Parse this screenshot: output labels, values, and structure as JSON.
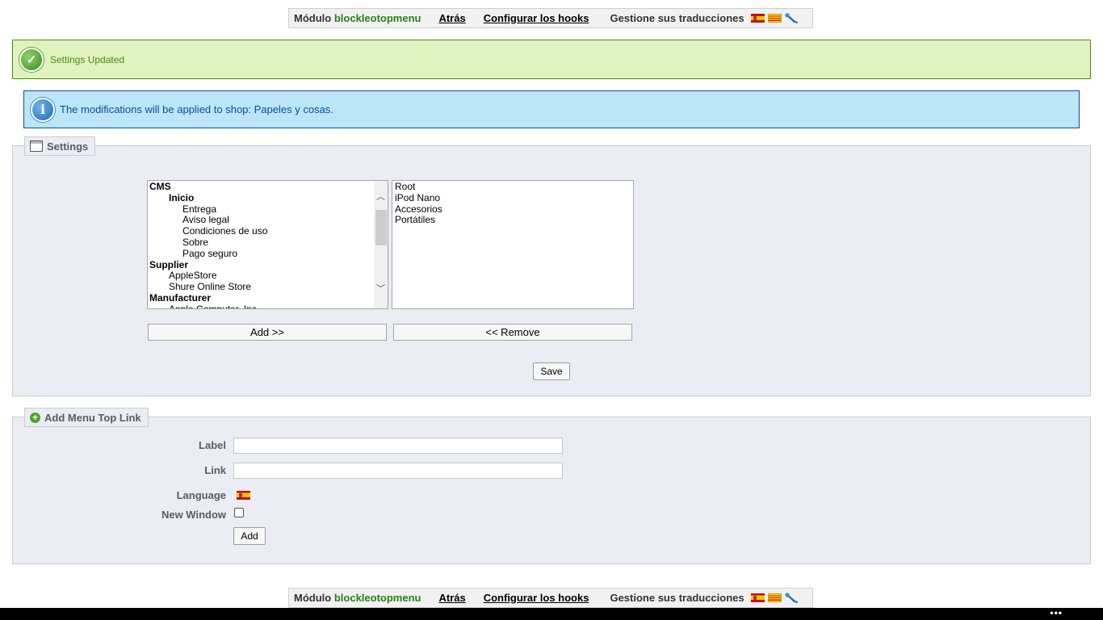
{
  "toolbar": {
    "module_prefix": "Módulo",
    "module_name": "blockleotopmenu",
    "back_label": "Atrás",
    "hooks_label": "Configurar los hooks",
    "translations_label": "Gestione sus traducciones",
    "flags": [
      "es-flag",
      "ca-flag"
    ],
    "tool_icon": "wrench-icon"
  },
  "alerts": {
    "success_text": "Settings Updated",
    "info_text": "The modifications will be applied to shop: Papeles y cosas."
  },
  "settings": {
    "legend": "Settings",
    "available_items": [
      {
        "label": "CMS",
        "level": 0,
        "group": true
      },
      {
        "label": "Inicio",
        "level": 1,
        "group": true
      },
      {
        "label": "Entrega",
        "level": 2,
        "group": false
      },
      {
        "label": "Aviso legal",
        "level": 2,
        "group": false
      },
      {
        "label": "Condiciones de uso",
        "level": 2,
        "group": false
      },
      {
        "label": "Sobre",
        "level": 2,
        "group": false
      },
      {
        "label": "Pago seguro",
        "level": 2,
        "group": false
      },
      {
        "label": "Supplier",
        "level": 0,
        "group": true
      },
      {
        "label": "AppleStore",
        "level": 1,
        "group": false
      },
      {
        "label": "Shure Online Store",
        "level": 1,
        "group": false
      },
      {
        "label": "Manufacturer",
        "level": 0,
        "group": true
      },
      {
        "label": "Apple Computer, Inc",
        "level": 1,
        "group": false
      }
    ],
    "selected_items": [
      "Root",
      "iPod Nano",
      "Accesorios",
      "Portátiles"
    ],
    "add_button": "Add >>",
    "remove_button": "<< Remove",
    "save_button": "Save"
  },
  "add_link": {
    "legend": "Add Menu Top Link",
    "label_field_label": "Label",
    "label_value": "",
    "link_field_label": "Link",
    "link_value": "",
    "language_label": "Language",
    "new_window_label": "New Window",
    "new_window_checked": false,
    "add_button": "Add"
  },
  "colors": {
    "success_bg": "#dff2bf",
    "success_text": "#4f8a10",
    "info_bg": "#bde5f8",
    "info_text": "#00529b",
    "module_name": "#268217",
    "panel_bg": "#ebedf4"
  }
}
